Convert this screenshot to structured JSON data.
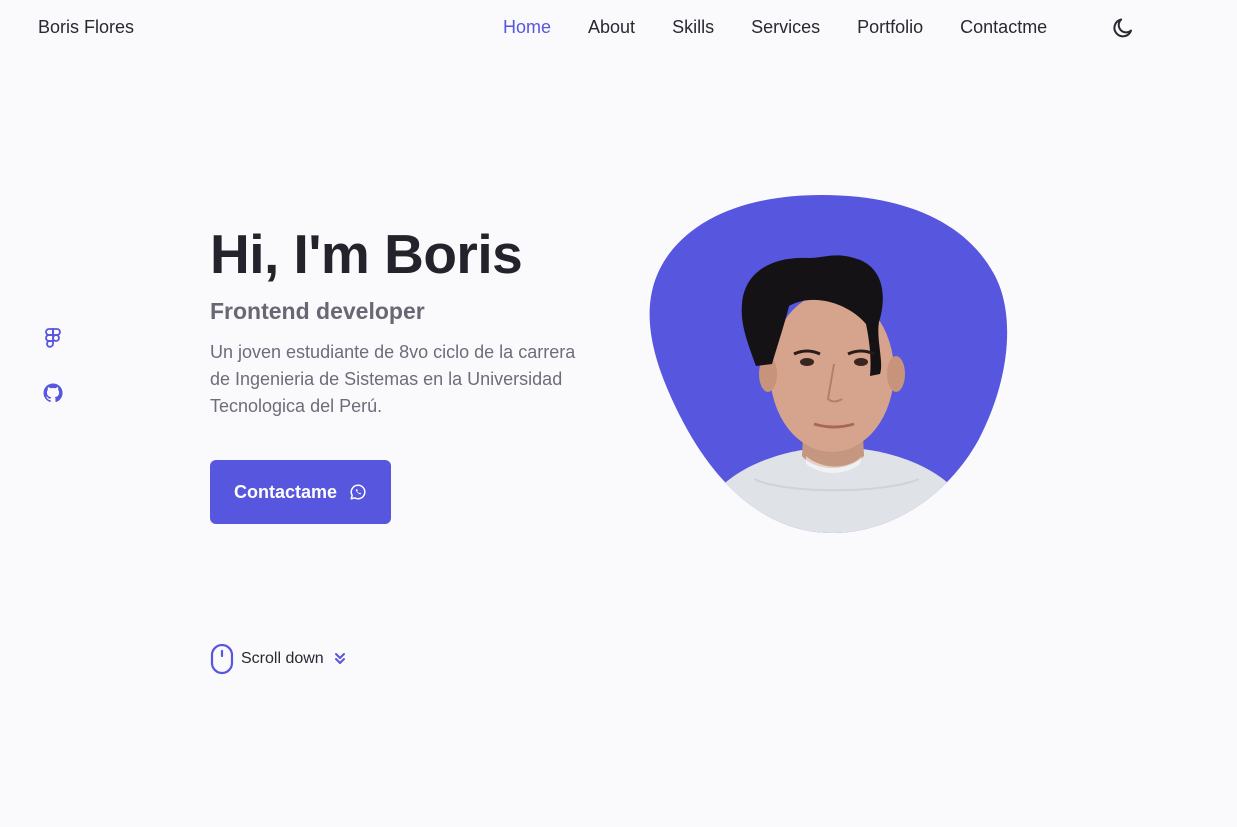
{
  "header": {
    "logo": "Boris Flores",
    "nav": [
      {
        "label": "Home",
        "active": true
      },
      {
        "label": "About",
        "active": false
      },
      {
        "label": "Skills",
        "active": false
      },
      {
        "label": "Services",
        "active": false
      },
      {
        "label": "Portfolio",
        "active": false
      },
      {
        "label": "Contactme",
        "active": false
      }
    ],
    "theme_icon": "moon-icon"
  },
  "social": [
    {
      "icon": "figma-icon"
    },
    {
      "icon": "github-icon"
    }
  ],
  "hero": {
    "title": "Hi, I'm Boris",
    "subtitle": "Frontend developer",
    "description": "Un joven estudiante de 8vo ciclo de la carrera de Ingenieria de Sistemas en la Universidad Tecnologica del Perú.",
    "cta_label": "Contactame",
    "cta_icon": "whatsapp-icon",
    "image": "profile-photo"
  },
  "scroll": {
    "label": "Scroll down",
    "icon": "mouse-icon",
    "arrow_icon": "double-chevron-down-icon"
  },
  "colors": {
    "accent": "#5756de",
    "background": "#faf9fc",
    "title": "#24222a",
    "text": "#6f6c7a"
  }
}
